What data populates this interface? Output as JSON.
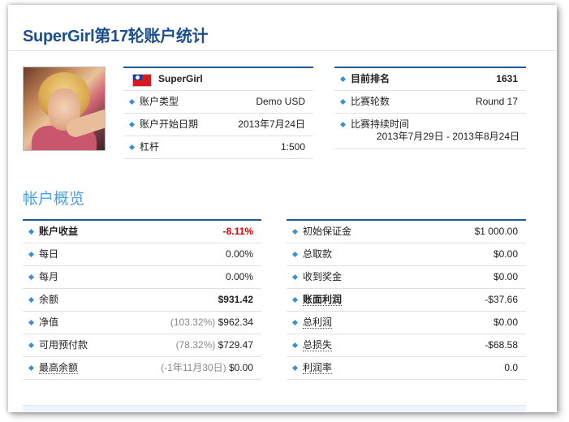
{
  "page": {
    "title": "SuperGirl第17轮账户统计"
  },
  "profile": {
    "name": "SuperGirl",
    "flag_icon": "taiwan-flag-icon",
    "rows": [
      {
        "label": "账户类型",
        "value": "Demo USD"
      },
      {
        "label": "账户开始日期",
        "value": "2013年7月24日"
      },
      {
        "label": "杠杆",
        "value": "1:500"
      }
    ]
  },
  "contest": {
    "rank_label": "目前排名",
    "rank_value": "1631",
    "round_label": "比赛轮数",
    "round_value": "Round 17",
    "duration_label": "比赛持续时间",
    "duration_value": "2013年7月29日 - 2013年8月24日"
  },
  "overview": {
    "title": "帐户概览",
    "left": {
      "profit": {
        "label": "账户收益",
        "value": "-8.11%"
      },
      "daily": {
        "label": "每日",
        "value": "0.00%"
      },
      "monthly": {
        "label": "每月",
        "value": "0.00%"
      },
      "balance": {
        "label": "余额",
        "value": "$931.42"
      },
      "equity": {
        "label": "净值",
        "pct": "(103.32%)",
        "value": "$962.34"
      },
      "free_margin": {
        "label": "可用预付款",
        "pct": "(78.32%)",
        "value": "$729.47"
      },
      "max_balance": {
        "label": "最高余额",
        "pct": "(-1年11月30日)",
        "value": "$0.00"
      }
    },
    "right": {
      "initial_deposit": {
        "label": "初始保证金",
        "value": "$1 000.00"
      },
      "withdrawals": {
        "label": "总取款",
        "value": "$0.00"
      },
      "bonus": {
        "label": "收到奖金",
        "value": "$0.00"
      },
      "book_profit": {
        "label": "账面利润",
        "value": "-$37.66"
      },
      "gross_profit": {
        "label": "总利润",
        "value": "$0.00"
      },
      "gross_loss": {
        "label": "总损失",
        "value": "-$68.58"
      },
      "profit_factor": {
        "label": "利润率",
        "value": "0.0"
      }
    }
  },
  "colors": {
    "title": "#1d4f8c",
    "section_title": "#4aa0e6",
    "table_border": "#1d5a96",
    "negative": "#e30000",
    "bullet": "#3b8fd9"
  }
}
